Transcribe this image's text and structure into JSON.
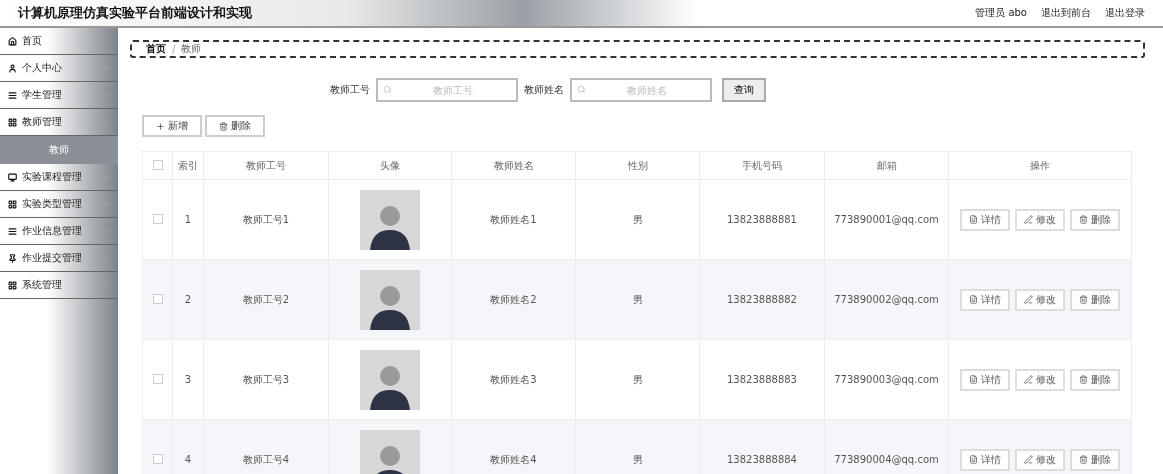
{
  "header": {
    "title": "计算机原理仿真实验平台前端设计和实现",
    "user": "管理员 abo",
    "links": [
      "退出到前台",
      "退出登录"
    ]
  },
  "sidebar": {
    "items": [
      {
        "label": "首页",
        "kind": "link",
        "selected": false
      },
      {
        "label": "个人中心",
        "kind": "menu",
        "selected": false
      },
      {
        "label": "学生管理",
        "kind": "menu",
        "selected": false
      },
      {
        "label": "教师管理",
        "kind": "menu",
        "selected": false,
        "children": [
          {
            "label": "教师",
            "selected": true
          }
        ]
      },
      {
        "label": "实验课程管理",
        "kind": "menu",
        "selected": false
      },
      {
        "label": "实验类型管理",
        "kind": "menu",
        "selected": false
      },
      {
        "label": "作业信息管理",
        "kind": "menu",
        "selected": false
      },
      {
        "label": "作业提交管理",
        "kind": "menu",
        "selected": false
      },
      {
        "label": "系统管理",
        "kind": "menu",
        "selected": false
      }
    ]
  },
  "breadcrumb": {
    "items": [
      "首页",
      "教师"
    ],
    "separator": "/"
  },
  "search": {
    "fields": [
      {
        "label": "教师工号",
        "placeholder": "教师工号"
      },
      {
        "label": "教师姓名",
        "placeholder": "教师姓名"
      }
    ],
    "button": "查询"
  },
  "toolbar": [
    {
      "label": "新增",
      "kind": "add"
    },
    {
      "label": "删除",
      "kind": "delete"
    }
  ],
  "table": {
    "select_all_checked": false,
    "columns": [
      "索引",
      "教师工号",
      "头像",
      "教师姓名",
      "性别",
      "手机号码",
      "邮箱",
      "操作"
    ],
    "rows": [
      {
        "checked": false,
        "index": "1",
        "id": "教师工号1",
        "name": "教师姓名1",
        "gender": "男",
        "phone": "13823888881",
        "email": "773890001@qq.com",
        "actions": [
          {
            "label": "详情",
            "kind": "detail"
          },
          {
            "label": "修改",
            "kind": "edit"
          },
          {
            "label": "删除",
            "kind": "delete"
          }
        ]
      },
      {
        "checked": false,
        "index": "2",
        "id": "教师工号2",
        "name": "教师姓名2",
        "gender": "男",
        "phone": "13823888882",
        "email": "773890002@qq.com",
        "actions": [
          {
            "label": "详情",
            "kind": "detail"
          },
          {
            "label": "修改",
            "kind": "edit"
          },
          {
            "label": "删除",
            "kind": "delete"
          }
        ]
      },
      {
        "checked": false,
        "index": "3",
        "id": "教师工号3",
        "name": "教师姓名3",
        "gender": "男",
        "phone": "13823888883",
        "email": "773890003@qq.com",
        "actions": [
          {
            "label": "详情",
            "kind": "detail"
          },
          {
            "label": "修改",
            "kind": "edit"
          },
          {
            "label": "删除",
            "kind": "delete"
          }
        ]
      },
      {
        "checked": false,
        "index": "4",
        "id": "教师工号4",
        "name": "教师姓名4",
        "gender": "男",
        "phone": "13823888884",
        "email": "773890004@qq.com",
        "actions": [
          {
            "label": "详情",
            "kind": "detail"
          },
          {
            "label": "修改",
            "kind": "edit"
          },
          {
            "label": "删除",
            "kind": "delete"
          }
        ]
      }
    ]
  }
}
